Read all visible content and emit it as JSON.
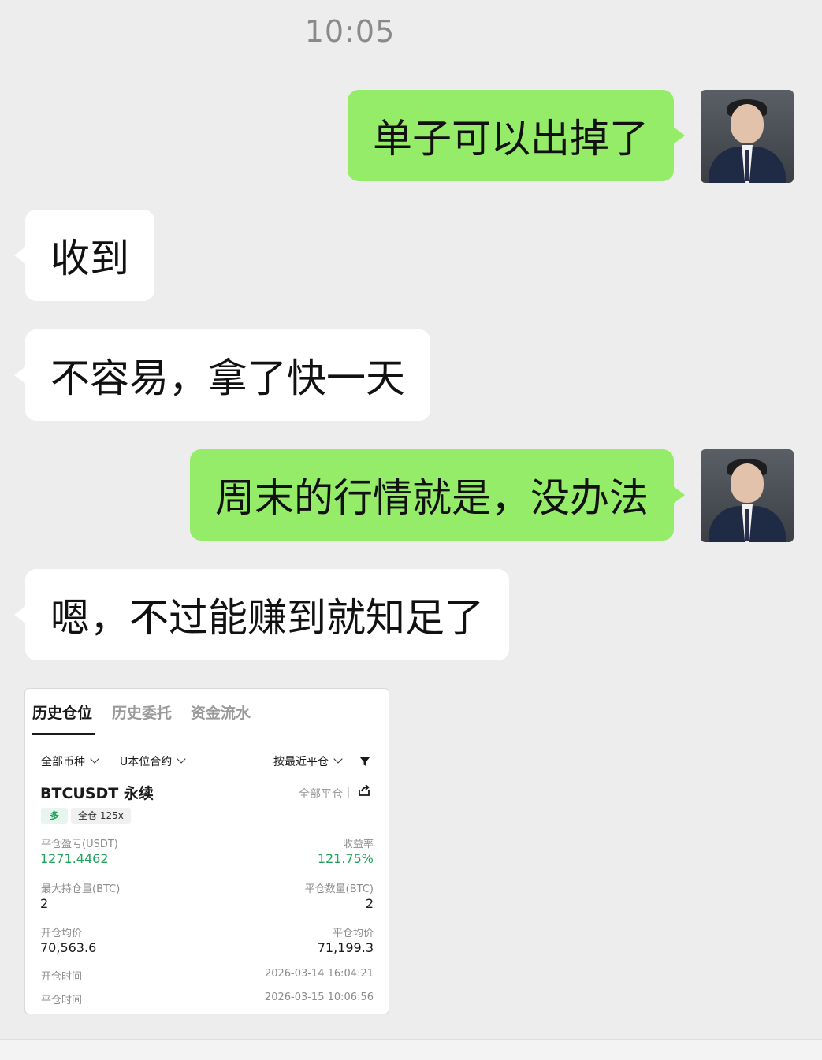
{
  "chat": {
    "timestamp": "10:05",
    "messages": [
      {
        "direction": "out",
        "text": "单子可以出掉了"
      },
      {
        "direction": "in",
        "text": "收到"
      },
      {
        "direction": "in",
        "text": "不容易，拿了快一天"
      },
      {
        "direction": "out",
        "text": "周末的行情就是，没办法"
      },
      {
        "direction": "in",
        "text": "嗯，不过能赚到就知足了"
      }
    ],
    "bubble_colors": {
      "out": "#95ec69",
      "in": "#ffffff"
    }
  },
  "screenshot": {
    "tabs": [
      "历史仓位",
      "历史委托",
      "资金流水"
    ],
    "active_tab": "历史仓位",
    "filters": {
      "coin": "全部币种",
      "contract": "U本位合约",
      "sort": "按最近平仓"
    },
    "pair": "BTCUSDT 永续",
    "close_all": "全部平仓",
    "tag_side": "多",
    "tag_margin": "全仓 125x",
    "fields": {
      "pnl_label": "平仓盈亏(USDT)",
      "pnl_value": "1271.4462",
      "roi_label": "收益率",
      "roi_value": "121.75%",
      "max_pos_label": "最大持仓量(BTC)",
      "max_pos_value": "2",
      "close_qty_label": "平仓数量(BTC)",
      "close_qty_value": "2",
      "open_avg_label": "开仓均价",
      "open_avg_value": "70,563.6",
      "close_avg_label": "平仓均价",
      "close_avg_value": "71,199.3",
      "open_time_label": "开仓时间",
      "open_time_value": "2026-03-14 16:04:21",
      "close_time_label": "平仓时间",
      "close_time_value": "2026-03-15 10:06:56"
    },
    "accent_green": "#22a35a"
  }
}
